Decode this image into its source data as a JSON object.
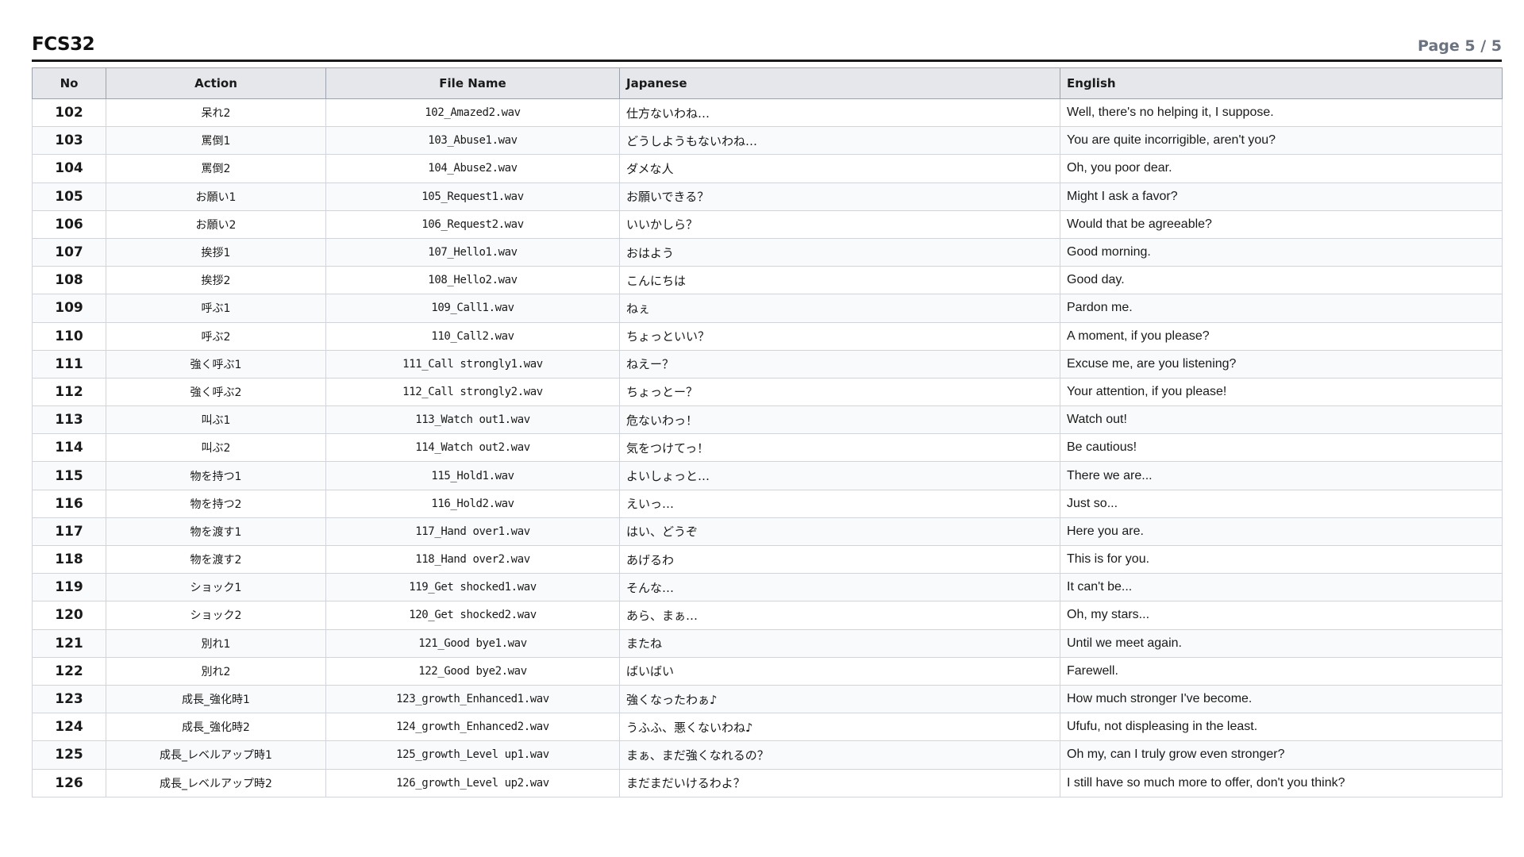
{
  "header": {
    "title": "FCS32",
    "page_indicator": "Page 5 / 5"
  },
  "table": {
    "columns": [
      "No",
      "Action",
      "File Name",
      "Japanese",
      "English"
    ],
    "rows": [
      {
        "no": "102",
        "action": "呆れ2",
        "file": "102_Amazed2.wav",
        "japanese": "仕方ないわね…",
        "english": "Well, there's no helping it, I suppose."
      },
      {
        "no": "103",
        "action": "罵倒1",
        "file": "103_Abuse1.wav",
        "japanese": "どうしようもないわね…",
        "english": "You are quite incorrigible, aren't you?"
      },
      {
        "no": "104",
        "action": "罵倒2",
        "file": "104_Abuse2.wav",
        "japanese": "ダメな人",
        "english": "Oh, you poor dear."
      },
      {
        "no": "105",
        "action": "お願い1",
        "file": "105_Request1.wav",
        "japanese": "お願いできる？",
        "english": "Might I ask a favor?"
      },
      {
        "no": "106",
        "action": "お願い2",
        "file": "106_Request2.wav",
        "japanese": "いいかしら？",
        "english": "Would that be agreeable?"
      },
      {
        "no": "107",
        "action": "挨拶1",
        "file": "107_Hello1.wav",
        "japanese": "おはよう",
        "english": "Good morning."
      },
      {
        "no": "108",
        "action": "挨拶2",
        "file": "108_Hello2.wav",
        "japanese": "こんにちは",
        "english": "Good day."
      },
      {
        "no": "109",
        "action": "呼ぶ1",
        "file": "109_Call1.wav",
        "japanese": "ねぇ",
        "english": "Pardon me."
      },
      {
        "no": "110",
        "action": "呼ぶ2",
        "file": "110_Call2.wav",
        "japanese": "ちょっといい？",
        "english": "A moment, if you please?"
      },
      {
        "no": "111",
        "action": "強く呼ぶ1",
        "file": "111_Call strongly1.wav",
        "japanese": "ねえー？",
        "english": "Excuse me, are you listening?"
      },
      {
        "no": "112",
        "action": "強く呼ぶ2",
        "file": "112_Call strongly2.wav",
        "japanese": "ちょっとー？",
        "english": "Your attention, if you please!"
      },
      {
        "no": "113",
        "action": "叫ぶ1",
        "file": "113_Watch out1.wav",
        "japanese": "危ないわっ！",
        "english": "Watch out!"
      },
      {
        "no": "114",
        "action": "叫ぶ2",
        "file": "114_Watch out2.wav",
        "japanese": "気をつけてっ！",
        "english": "Be cautious!"
      },
      {
        "no": "115",
        "action": "物を持つ1",
        "file": "115_Hold1.wav",
        "japanese": "よいしょっと…",
        "english": "There we are..."
      },
      {
        "no": "116",
        "action": "物を持つ2",
        "file": "116_Hold2.wav",
        "japanese": "えいっ…",
        "english": "Just so..."
      },
      {
        "no": "117",
        "action": "物を渡す1",
        "file": "117_Hand over1.wav",
        "japanese": "はい、どうぞ",
        "english": "Here you are."
      },
      {
        "no": "118",
        "action": "物を渡す2",
        "file": "118_Hand over2.wav",
        "japanese": "あげるわ",
        "english": "This is for you."
      },
      {
        "no": "119",
        "action": "ショック1",
        "file": "119_Get shocked1.wav",
        "japanese": "そんな…",
        "english": "It can't be..."
      },
      {
        "no": "120",
        "action": "ショック2",
        "file": "120_Get shocked2.wav",
        "japanese": "あら、まぁ…",
        "english": "Oh, my stars..."
      },
      {
        "no": "121",
        "action": "別れ1",
        "file": "121_Good bye1.wav",
        "japanese": "またね",
        "english": "Until we meet again."
      },
      {
        "no": "122",
        "action": "別れ2",
        "file": "122_Good bye2.wav",
        "japanese": "ばいばい",
        "english": "Farewell."
      },
      {
        "no": "123",
        "action": "成長_強化時1",
        "file": "123_growth_Enhanced1.wav",
        "japanese": "強くなったわぁ♪",
        "english": "How much stronger I've become."
      },
      {
        "no": "124",
        "action": "成長_強化時2",
        "file": "124_growth_Enhanced2.wav",
        "japanese": "うふふ、悪くないわね♪",
        "english": "Ufufu, not displeasing in the least."
      },
      {
        "no": "125",
        "action": "成長_レベルアップ時1",
        "file": "125_growth_Level up1.wav",
        "japanese": "まぁ、まだ強くなれるの？",
        "english": "Oh my, can I truly grow even stronger?"
      },
      {
        "no": "126",
        "action": "成長_レベルアップ時2",
        "file": "126_growth_Level up2.wav",
        "japanese": "まだまだいけるわよ？",
        "english": "I still have so much more to offer, don't you think?"
      }
    ]
  }
}
